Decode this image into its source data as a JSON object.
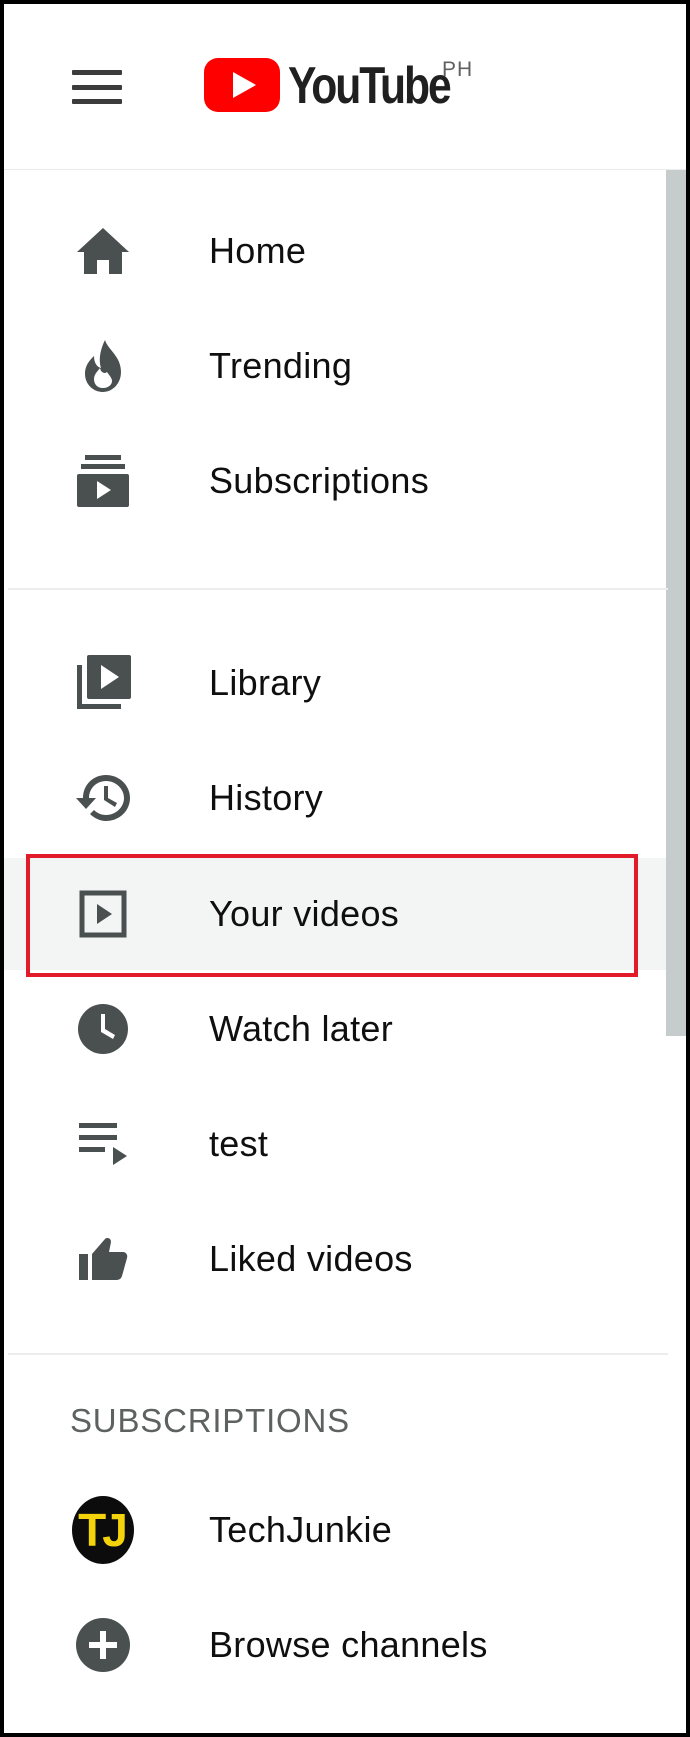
{
  "header": {
    "logo_text": "YouTube",
    "region": "PH"
  },
  "menu": {
    "main": [
      {
        "id": "home",
        "label": "Home",
        "icon": "home-icon"
      },
      {
        "id": "trending",
        "label": "Trending",
        "icon": "flame-icon"
      },
      {
        "id": "subscriptions",
        "label": "Subscriptions",
        "icon": "subscriptions-icon"
      }
    ],
    "library": [
      {
        "id": "library",
        "label": "Library",
        "icon": "library-icon"
      },
      {
        "id": "history",
        "label": "History",
        "icon": "history-icon"
      },
      {
        "id": "your-videos",
        "label": "Your videos",
        "icon": "play-square-icon",
        "highlighted": true
      },
      {
        "id": "watch-later",
        "label": "Watch later",
        "icon": "clock-icon"
      },
      {
        "id": "test",
        "label": "test",
        "icon": "playlist-icon"
      },
      {
        "id": "liked-videos",
        "label": "Liked videos",
        "icon": "thumbs-up-icon"
      }
    ]
  },
  "subscriptions_section": {
    "title": "SUBSCRIPTIONS",
    "channels": [
      {
        "label": "TechJunkie",
        "avatar_text": "TJ"
      },
      {
        "label": "Browse channels",
        "icon": "plus-circle-icon"
      }
    ]
  },
  "colors": {
    "brand_red": "#ff0000",
    "highlight_border": "#e21b2b",
    "icon_gray": "#4a4f4f",
    "avatar_yellow": "#f4d30b"
  }
}
